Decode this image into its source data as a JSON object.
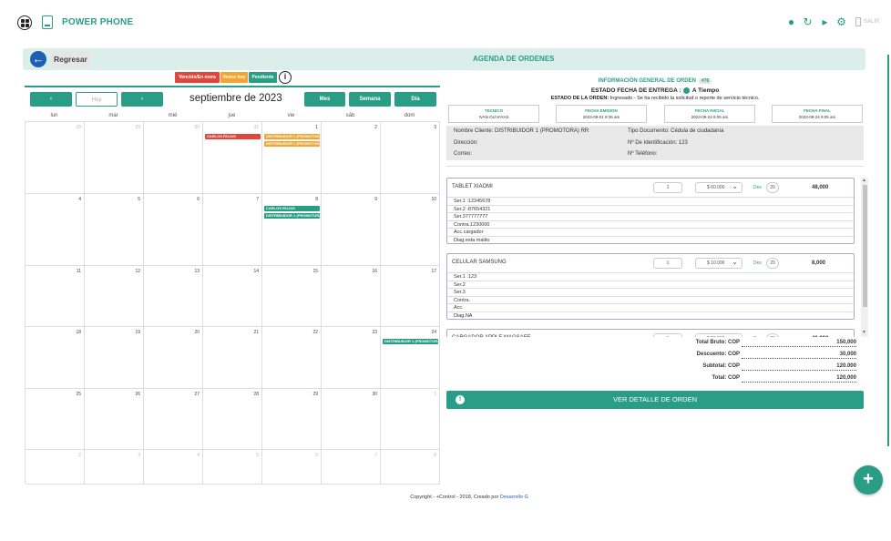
{
  "app": {
    "name": "POWER PHONE",
    "salir": "SALIR"
  },
  "topbar_icons": [
    "user-icon",
    "refresh-icon",
    "megaphone-icon",
    "gear-icon"
  ],
  "header": {
    "back": "Regresar",
    "title": "AGENDA DE ORDENES"
  },
  "legend": {
    "overdue": "Vencido/En mora",
    "due_today": "Vence hoy",
    "pending": "Pendiente"
  },
  "calendar": {
    "prev": "‹",
    "today": "Hoy",
    "next": "›",
    "title": "septiembre de 2023",
    "views": [
      "Mes",
      "Semana",
      "Día"
    ],
    "day_names": [
      "lun",
      "mar",
      "mié",
      "jue",
      "vie",
      "sáb",
      "dom"
    ],
    "weeks": [
      [
        {
          "d": "28",
          "dim": true
        },
        {
          "d": "29",
          "dim": true
        },
        {
          "d": "30",
          "dim": true
        },
        {
          "d": "31",
          "dim": true
        },
        {
          "d": "1"
        },
        {
          "d": "2"
        },
        {
          "d": "3"
        }
      ],
      [
        {
          "d": "4"
        },
        {
          "d": "5"
        },
        {
          "d": "6"
        },
        {
          "d": "7"
        },
        {
          "d": "8"
        },
        {
          "d": "9"
        },
        {
          "d": "10"
        }
      ],
      [
        {
          "d": "11"
        },
        {
          "d": "12"
        },
        {
          "d": "13"
        },
        {
          "d": "14"
        },
        {
          "d": "15"
        },
        {
          "d": "16"
        },
        {
          "d": "17"
        }
      ],
      [
        {
          "d": "18"
        },
        {
          "d": "19"
        },
        {
          "d": "20"
        },
        {
          "d": "21"
        },
        {
          "d": "22"
        },
        {
          "d": "23"
        },
        {
          "d": "24"
        }
      ],
      [
        {
          "d": "25"
        },
        {
          "d": "26"
        },
        {
          "d": "27"
        },
        {
          "d": "28"
        },
        {
          "d": "29"
        },
        {
          "d": "30"
        },
        {
          "d": "1",
          "dim": true
        }
      ],
      [
        {
          "d": "2",
          "dim": true
        },
        {
          "d": "3",
          "dim": true
        },
        {
          "d": "4",
          "dim": true
        },
        {
          "d": "5",
          "dim": true
        },
        {
          "d": "6",
          "dim": true
        },
        {
          "d": "7",
          "dim": true
        },
        {
          "d": "8",
          "dim": true
        }
      ]
    ],
    "events": [
      {
        "label": "CARLOS ROJAS",
        "week": 0,
        "start": 3,
        "span": 1,
        "row": 0,
        "status": "overdue"
      },
      {
        "label": "DISTRIBUIDOR 1 (PROMOTORA) RR",
        "week": 0,
        "start": 4,
        "span": 1,
        "row": 0,
        "status": "due_today"
      },
      {
        "label": "DISTRIBUIDOR 1 (PROMOTORA) RR",
        "week": 0,
        "start": 4,
        "span": 1,
        "row": 1,
        "status": "due_today"
      },
      {
        "label": "CARLOS ROJAS",
        "week": 1,
        "start": 4,
        "span": 1,
        "row": 0,
        "status": "pending"
      },
      {
        "label": "DISTRIBUIDOR 1 (PROMOTORA) RR",
        "week": 1,
        "start": 4,
        "span": 1,
        "row": 1,
        "status": "pending"
      },
      {
        "label": "DISTRIBUIDOR 1 (PROMOTORA) RR",
        "week": 3,
        "start": 6,
        "span": 1,
        "row": 0,
        "status": "pending"
      }
    ]
  },
  "order": {
    "info_title": "INFORMACIÓN GENERAL DE ORDEN",
    "number": "#76",
    "entrega_label": "ESTADO FECHA DE ENTREGA :",
    "entrega_value": "A Tiempo",
    "estado_label": "ESTADO DE LA ORDEN:",
    "estado_value": "Ingresado - Se ha recibido la solicitud o reporte de servicio técnico.",
    "dates": [
      {
        "h": "TECNICO",
        "v": "IVAN OLIVAYAS"
      },
      {
        "h": "FECHA EMISION",
        "v": "2023-09-01 9:36 am"
      },
      {
        "h": "FECHA INICIAL",
        "v": "2023-09-24 9:05 am"
      },
      {
        "h": "FECHA FINAL",
        "v": "2023-09-24 9:05 am"
      }
    ],
    "client": {
      "nombre": "Nombre Cliente: DISTRIBUIDOR 1 (PROMOTORA) RR",
      "tipo_doc": "Tipo Documento: Cédula de ciudadanía",
      "direccion": "Dirección:",
      "identificacion": "Nº De Identificación: 123",
      "correo": "Correo:",
      "telefono": "Nº Teléfono:"
    },
    "items": [
      {
        "name": "TABLET XIAOMI",
        "qty": "1",
        "price": "$ 60.000",
        "des": "Des",
        "discount": "20",
        "total": "48,000",
        "lines": [
          "Ser.1 :12345678",
          "Ser.2 :87654321",
          "Ser.377777777",
          "Contra.1230000",
          "Acc.cargador",
          "Diag.esta malito"
        ]
      },
      {
        "name": "CELULAR SAMSUNG",
        "qty": "1",
        "price": "$ 10.000",
        "des": "Des",
        "discount": "20",
        "total": "8,000",
        "lines": [
          "Ser.1 :123",
          "Ser.2",
          "Ser.3",
          "Contra.",
          "Acc.",
          "Diag.NA"
        ]
      },
      {
        "name": "CARGADOR APPLE MAGSAFE",
        "qty": "1",
        "price": "$ 50.000",
        "des": "Des",
        "discount": "20",
        "total": "40,000",
        "lines": []
      }
    ],
    "totals": [
      {
        "label": "Total Bruto: COP",
        "value": "150,000"
      },
      {
        "label": "Descuento: COP",
        "value": "30,000"
      },
      {
        "label": "Subtotal: COP",
        "value": "120.000"
      },
      {
        "label": "Total: COP",
        "value": "120,000"
      }
    ],
    "detail_button": "VER DETALLE DE ORDEN"
  },
  "footer": {
    "text": "Copyright - +Control - 2018, Creado por ",
    "link": "Desarrollo G"
  },
  "colors": {
    "accent": "#2a9d86",
    "overdue": "#e0463c",
    "due_today": "#f2a532",
    "pending": "#2a9d86",
    "back": "#1f5fb3"
  }
}
